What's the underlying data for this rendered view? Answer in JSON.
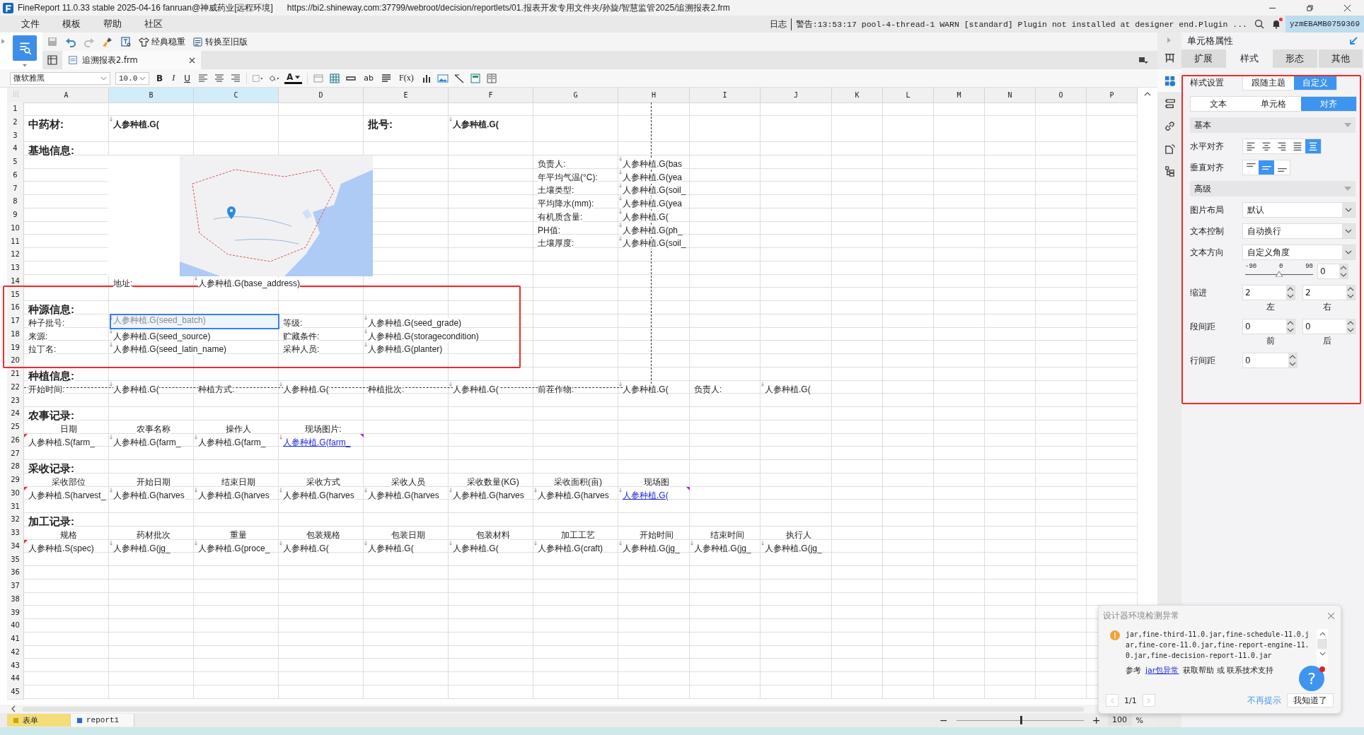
{
  "window": {
    "app": "FineReport 11.0.33 stable 2025-04-16 fanruan@神威药业[远程环境]",
    "url": "https://bi2.shineway.com:37799/webroot/decision/reportlets/01.报表开发专用文件夹/孙旋/智慧监管2025/追溯报表2.frm"
  },
  "menu": [
    "文件",
    "模板",
    "帮助",
    "社区"
  ],
  "log": {
    "label": "日志",
    "message": "警告:13:53:17 pool-4-thread-1 WARN [standard] Plugin not installed at designer end.Plugin ..."
  },
  "notification": {
    "unread": true
  },
  "user": "yzmEBAMB0759369",
  "toolbar": {
    "buttons": [
      "经典稳重",
      "转换至旧版"
    ]
  },
  "file_tab": {
    "label": "追溯报表2.frm",
    "selected": true
  },
  "format_bar": {
    "font": "微软雅黑",
    "size": "10.0",
    "bold": "B",
    "italic": "I",
    "underline": "U",
    "font_color": "A",
    "text_field": "ab",
    "formula": "F(x)"
  },
  "columns": [
    {
      "label": "A",
      "selected": false
    },
    {
      "label": "B",
      "selected": true
    },
    {
      "label": "C",
      "selected": true
    },
    {
      "label": "D",
      "selected": false
    },
    {
      "label": "E",
      "selected": false
    },
    {
      "label": "F",
      "selected": false
    },
    {
      "label": "G",
      "selected": false
    },
    {
      "label": "H",
      "selected": false
    },
    {
      "label": "I",
      "selected": false
    },
    {
      "label": "J",
      "selected": false
    },
    {
      "label": "K",
      "selected": false
    },
    {
      "label": "L",
      "selected": false
    },
    {
      "label": "M",
      "selected": false
    },
    {
      "label": "N",
      "selected": false
    },
    {
      "label": "O",
      "selected": false
    },
    {
      "label": "P",
      "selected": false
    }
  ],
  "rows": [
    {
      "number": "1"
    },
    {
      "number": "2",
      "cells": [
        {
          "kind": "title",
          "text": "中药材:",
          "selected": false
        },
        {
          "kind": "formula",
          "text": "人参种植.G(",
          "bold": true,
          "selected": false
        },
        {
          "kind": "empty"
        },
        {
          "kind": "empty"
        },
        {
          "kind": "title",
          "text": "批号:",
          "selected": false
        },
        {
          "kind": "formula",
          "text": "人参种植.G(",
          "bold": true,
          "selected": false
        }
      ]
    },
    {
      "number": "3"
    },
    {
      "number": "4",
      "cells": [
        {
          "kind": "title",
          "text": "基地信息:",
          "selected": false
        }
      ]
    },
    {
      "number": "5",
      "cells": [
        {
          "kind": "empty"
        },
        {
          "kind": "picture"
        },
        {
          "kind": "empty"
        },
        {
          "kind": "empty"
        },
        {
          "kind": "empty"
        },
        {
          "kind": "empty"
        },
        {
          "kind": "label",
          "text": "负责人:",
          "selected": false
        },
        {
          "kind": "formula",
          "text": "人参种植.G(bas",
          "selected": false
        }
      ]
    },
    {
      "number": "6",
      "cells": [
        {
          "kind": "empty"
        },
        {
          "kind": "empty"
        },
        {
          "kind": "empty"
        },
        {
          "kind": "empty"
        },
        {
          "kind": "empty"
        },
        {
          "kind": "empty"
        },
        {
          "kind": "label",
          "text": "年平均气温(°C):",
          "selected": false
        },
        {
          "kind": "formula",
          "text": "人参种植.G(yea",
          "selected": false
        }
      ]
    },
    {
      "number": "7",
      "cells": [
        {
          "kind": "empty"
        },
        {
          "kind": "empty"
        },
        {
          "kind": "empty"
        },
        {
          "kind": "empty"
        },
        {
          "kind": "empty"
        },
        {
          "kind": "empty"
        },
        {
          "kind": "label",
          "text": "土壤类型:",
          "selected": false
        },
        {
          "kind": "formula",
          "text": "人参种植.G(soil_",
          "selected": false
        }
      ]
    },
    {
      "number": "8",
      "cells": [
        {
          "kind": "empty"
        },
        {
          "kind": "empty"
        },
        {
          "kind": "empty"
        },
        {
          "kind": "empty"
        },
        {
          "kind": "empty"
        },
        {
          "kind": "empty"
        },
        {
          "kind": "label",
          "text": "平均降水(mm):",
          "selected": false
        },
        {
          "kind": "formula",
          "text": "人参种植.G(yea",
          "selected": false
        }
      ]
    },
    {
      "number": "9",
      "cells": [
        {
          "kind": "empty"
        },
        {
          "kind": "empty"
        },
        {
          "kind": "empty"
        },
        {
          "kind": "empty"
        },
        {
          "kind": "empty"
        },
        {
          "kind": "empty"
        },
        {
          "kind": "label",
          "text": "有机质含量:",
          "selected": false
        },
        {
          "kind": "formula",
          "text": "人参种植.G(",
          "selected": false
        }
      ]
    },
    {
      "number": "10",
      "cells": [
        {
          "kind": "empty"
        },
        {
          "kind": "empty"
        },
        {
          "kind": "empty"
        },
        {
          "kind": "empty"
        },
        {
          "kind": "empty"
        },
        {
          "kind": "empty"
        },
        {
          "kind": "label",
          "text": "PH值:",
          "selected": false
        },
        {
          "kind": "formula",
          "text": "人参种植.G(ph_",
          "selected": false
        }
      ]
    },
    {
      "number": "11",
      "cells": [
        {
          "kind": "empty"
        },
        {
          "kind": "empty"
        },
        {
          "kind": "empty"
        },
        {
          "kind": "empty"
        },
        {
          "kind": "empty"
        },
        {
          "kind": "empty"
        },
        {
          "kind": "label",
          "text": "土壤厚度:",
          "selected": false
        },
        {
          "kind": "formula",
          "text": "人参种植.G(soil_",
          "selected": false
        }
      ]
    },
    {
      "number": "12"
    },
    {
      "number": "13"
    },
    {
      "number": "14",
      "cells": [
        {
          "kind": "empty"
        },
        {
          "kind": "label",
          "text": "地址:",
          "selected": false
        },
        {
          "kind": "formula",
          "text": "人参种植.G(base_address)",
          "selected": false
        }
      ]
    },
    {
      "number": "15"
    },
    {
      "number": "16",
      "cells": [
        {
          "kind": "title",
          "text": "种源信息:",
          "selected": false
        }
      ]
    },
    {
      "number": "17",
      "cells": [
        {
          "kind": "label",
          "text": "种子批号:",
          "selected": false
        },
        {
          "kind": "formula",
          "text": "人参种植.G(seed_batch)",
          "selected": true
        },
        {
          "kind": "empty"
        },
        {
          "kind": "label",
          "text": "等级:",
          "selected": false
        },
        {
          "kind": "formula",
          "text": "人参种植.G(seed_grade)",
          "selected": false
        }
      ]
    },
    {
      "number": "18",
      "cells": [
        {
          "kind": "label",
          "text": "来源:",
          "selected": false
        },
        {
          "kind": "formula",
          "text": "人参种植.G(seed_source)",
          "selected": false
        },
        {
          "kind": "empty"
        },
        {
          "kind": "label",
          "text": "贮藏条件:",
          "selected": false
        },
        {
          "kind": "formula",
          "text": "人参种植.G(storagecondition)",
          "selected": false
        }
      ]
    },
    {
      "number": "19",
      "cells": [
        {
          "kind": "label",
          "text": "拉丁名:",
          "selected": false
        },
        {
          "kind": "formula",
          "text": "人参种植.G(seed_latin_name)",
          "selected": false
        },
        {
          "kind": "empty"
        },
        {
          "kind": "label",
          "text": "采种人员:",
          "selected": false
        },
        {
          "kind": "formula",
          "text": "人参种植.G(planter)",
          "selected": false
        }
      ]
    },
    {
      "number": "20"
    },
    {
      "number": "21",
      "cells": [
        {
          "kind": "title",
          "text": "种植信息:",
          "selected": false
        }
      ]
    },
    {
      "number": "22",
      "cells": [
        {
          "kind": "label",
          "text": "开始时间:",
          "selected": false
        },
        {
          "kind": "formula",
          "text": "人参种植.G(",
          "selected": false
        },
        {
          "kind": "label",
          "text": "种植方式:",
          "selected": false
        },
        {
          "kind": "formula",
          "text": "人参种植.G(",
          "selected": false
        },
        {
          "kind": "label",
          "text": "种植批次:",
          "selected": false
        },
        {
          "kind": "formula",
          "text": "人参种植.G(",
          "selected": false
        },
        {
          "kind": "label",
          "text": "前茬作物:",
          "selected": false
        },
        {
          "kind": "formula",
          "text": "人参种植.G(",
          "selected": false
        },
        {
          "kind": "label",
          "text": "负责人:",
          "selected": false
        },
        {
          "kind": "formula",
          "text": "人参种植.G(",
          "selected": false
        }
      ]
    },
    {
      "number": "23"
    },
    {
      "number": "24",
      "cells": [
        {
          "kind": "title",
          "text": "农事记录:",
          "selected": false
        }
      ]
    },
    {
      "number": "25",
      "cells": [
        {
          "kind": "header",
          "text": "日期",
          "selected": false
        },
        {
          "kind": "header",
          "text": "农事名称",
          "selected": false
        },
        {
          "kind": "header",
          "text": "操作人",
          "selected": false
        },
        {
          "kind": "header",
          "text": "现场图片:",
          "selected": false
        }
      ]
    },
    {
      "number": "26",
      "cells": [
        {
          "kind": "group",
          "text": "人参种植.S(farm_",
          "selected": false
        },
        {
          "kind": "formula",
          "text": "人参种植.G(farm_",
          "selected": false
        },
        {
          "kind": "formula",
          "text": "人参种植.G(farm_",
          "selected": false
        },
        {
          "kind": "link",
          "text": "人参种植.G(farm_",
          "selected": false
        }
      ]
    },
    {
      "number": "27"
    },
    {
      "number": "28",
      "cells": [
        {
          "kind": "title",
          "text": "采收记录:",
          "selected": false
        }
      ]
    },
    {
      "number": "29",
      "cells": [
        {
          "kind": "header",
          "text": "采收部位",
          "selected": false
        },
        {
          "kind": "header",
          "text": "开始日期",
          "selected": false
        },
        {
          "kind": "header",
          "text": "结束日期",
          "selected": false
        },
        {
          "kind": "header",
          "text": "采收方式",
          "selected": false
        },
        {
          "kind": "header",
          "text": "采收人员",
          "selected": false
        },
        {
          "kind": "header",
          "text": "采收数量(KG)",
          "selected": false
        },
        {
          "kind": "header",
          "text": "采收面积(亩)",
          "selected": false
        },
        {
          "kind": "header",
          "text": "现场图",
          "selected": false
        }
      ]
    },
    {
      "number": "30",
      "cells": [
        {
          "kind": "group",
          "text": "人参种植.S(harvest_",
          "selected": false
        },
        {
          "kind": "formula",
          "text": "人参种植.G(harves",
          "selected": false
        },
        {
          "kind": "formula",
          "text": "人参种植.G(harves",
          "selected": false
        },
        {
          "kind": "formula",
          "text": "人参种植.G(harves",
          "selected": false
        },
        {
          "kind": "formula",
          "text": "人参种植.G(harves",
          "selected": false
        },
        {
          "kind": "formula",
          "text": "人参种植.G(harves",
          "selected": false
        },
        {
          "kind": "formula",
          "text": "人参种植.G(harves",
          "selected": false
        },
        {
          "kind": "link",
          "text": "人参种植.G(",
          "selected": false
        }
      ]
    },
    {
      "number": "31"
    },
    {
      "number": "32",
      "cells": [
        {
          "kind": "title",
          "text": "加工记录:",
          "selected": false
        }
      ]
    },
    {
      "number": "33",
      "cells": [
        {
          "kind": "header",
          "text": "规格",
          "selected": false
        },
        {
          "kind": "header",
          "text": "药材批次",
          "selected": false
        },
        {
          "kind": "header",
          "text": "重量",
          "selected": false
        },
        {
          "kind": "header",
          "text": "包装规格",
          "selected": false
        },
        {
          "kind": "header",
          "text": "包装日期",
          "selected": false
        },
        {
          "kind": "header",
          "text": "包装材料",
          "selected": false
        },
        {
          "kind": "header",
          "text": "加工工艺",
          "selected": false
        },
        {
          "kind": "header",
          "text": "开始时间",
          "selected": false
        },
        {
          "kind": "header",
          "text": "结束时间",
          "selected": false
        },
        {
          "kind": "header",
          "text": "执行人",
          "selected": false
        }
      ]
    },
    {
      "number": "34",
      "cells": [
        {
          "kind": "group",
          "text": "人参种植.S(spec)",
          "selected": false
        },
        {
          "kind": "formula",
          "text": "人参种植.G(jg_",
          "selected": false
        },
        {
          "kind": "formula",
          "text": "人参种植.G(proce_",
          "selected": false
        },
        {
          "kind": "formula",
          "text": "人参种植.G(",
          "selected": false
        },
        {
          "kind": "formula",
          "text": "人参种植.G(",
          "selected": false
        },
        {
          "kind": "formula",
          "text": "人参种植.G(",
          "selected": false
        },
        {
          "kind": "formula",
          "text": "人参种植.G(craft)",
          "selected": false
        },
        {
          "kind": "formula",
          "text": "人参种植.G(jg_",
          "selected": false
        },
        {
          "kind": "formula",
          "text": "人参种植.G(jg_",
          "selected": false
        },
        {
          "kind": "formula",
          "text": "人参种植.G(jg_",
          "selected": false
        }
      ]
    },
    {
      "number": "35"
    },
    {
      "number": "36"
    },
    {
      "number": "37"
    },
    {
      "number": "38"
    },
    {
      "number": "39"
    },
    {
      "number": "40"
    },
    {
      "number": "41"
    },
    {
      "number": "42"
    },
    {
      "number": "43"
    },
    {
      "number": "44"
    },
    {
      "number": "45"
    }
  ],
  "sheet_tabs": [
    {
      "label": "表单",
      "selected": true
    },
    {
      "label": "report1",
      "selected": false
    }
  ],
  "zoom": {
    "minus": "−",
    "plus": "+",
    "value": "100",
    "unit": "%",
    "level": 0.5
  },
  "rail": [
    {
      "kind": "layout",
      "selected": false
    },
    {
      "kind": "cell",
      "selected": true
    },
    {
      "kind": "widget",
      "selected": false
    },
    {
      "kind": "link",
      "selected": false
    },
    {
      "kind": "rotate",
      "selected": false
    },
    {
      "kind": "tree",
      "selected": false
    }
  ],
  "panel": {
    "title": "单元格属性",
    "tabs": [
      {
        "label": "扩展",
        "selected": false
      },
      {
        "label": "样式",
        "selected": true
      },
      {
        "label": "形态",
        "selected": false
      },
      {
        "label": "其他",
        "selected": false
      }
    ],
    "style_setting": {
      "label": "样式设置",
      "options": [
        {
          "label": "跟随主题",
          "selected": false
        },
        {
          "label": "自定义",
          "selected": true
        }
      ]
    },
    "subtabs": [
      {
        "label": "文本",
        "selected": false
      },
      {
        "label": "单元格",
        "selected": false
      },
      {
        "label": "对齐",
        "selected": true
      }
    ],
    "basic": "基本",
    "h_align": {
      "label": "水平对齐",
      "options": [
        {
          "kind": "left",
          "selected": false
        },
        {
          "kind": "center",
          "selected": false
        },
        {
          "kind": "right",
          "selected": false
        },
        {
          "kind": "justify",
          "selected": false
        },
        {
          "kind": "distributed",
          "selected": true
        }
      ]
    },
    "v_align": {
      "label": "垂直对齐",
      "options": [
        {
          "kind": "top",
          "selected": false
        },
        {
          "kind": "middle",
          "selected": true
        },
        {
          "kind": "bottom",
          "selected": false
        }
      ]
    },
    "advanced": "高级",
    "selects": [
      {
        "label": "图片布局",
        "value": "默认"
      },
      {
        "label": "文本控制",
        "value": "自动换行"
      },
      {
        "label": "文本方向",
        "value": "自定义角度"
      }
    ],
    "angle": {
      "ticks": [
        "-90",
        "0",
        "90"
      ],
      "level": 0.5,
      "value": "0"
    },
    "indent": {
      "label": "缩进",
      "fields": [
        {
          "value": "2",
          "caption": "左"
        },
        {
          "value": "2",
          "caption": "右"
        }
      ]
    },
    "paragraph": {
      "label": "段间距",
      "fields": [
        {
          "value": "0",
          "caption": "前"
        },
        {
          "value": "0",
          "caption": "后"
        }
      ]
    },
    "line_spacing": {
      "label": "行间距",
      "value": "0"
    }
  },
  "popup": {
    "title": "设计器环境检测异常",
    "message": "jar,fine-third-11.0.jar,fine-schedule-11.0.jar,fine-core-11.0.jar,fine-report-engine-11.0.jar,fine-decision-report-11.0.jar",
    "help_prefix": "参考",
    "help_link": "jar包异常",
    "help_suffix": "获取帮助 或 联系技术支持",
    "pager": "1/1",
    "dismiss": "不再提示",
    "ok": "我知道了"
  },
  "help_button": {
    "label": "?",
    "unread": true
  }
}
